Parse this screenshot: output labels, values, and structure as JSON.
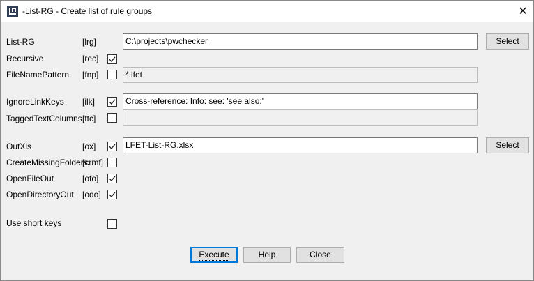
{
  "window": {
    "title": "-List-RG - Create list of rule groups",
    "close_glyph": "✕"
  },
  "rows": {
    "list_rg": {
      "label": "List-RG",
      "key": "[lrg]",
      "value": "C:\\projects\\pwchecker",
      "button": "Select"
    },
    "recursive": {
      "label": "Recursive",
      "key": "[rec]",
      "checked": true
    },
    "file_name_pattern": {
      "label": "FileNamePattern",
      "key": "[fnp]",
      "checked": false,
      "value": "*.lfet"
    },
    "ignore_link_keys": {
      "label": "IgnoreLinkKeys",
      "key": "[ilk]",
      "checked": true,
      "value": "Cross-reference: Info: see: 'see also:'"
    },
    "tagged_text_columns": {
      "label": "TaggedTextColumns",
      "key": "[ttc]",
      "checked": false,
      "value": ""
    },
    "out_xls": {
      "label": "OutXls",
      "key": "[ox]",
      "checked": true,
      "value": "LFET-List-RG.xlsx",
      "button": "Select"
    },
    "create_missing_folders": {
      "label": "CreateMissingFolders",
      "key": "[crmf]",
      "checked": false
    },
    "open_file_out": {
      "label": "OpenFileOut",
      "key": "[ofo]",
      "checked": true
    },
    "open_directory_out": {
      "label": "OpenDirectoryOut",
      "key": "[odo]",
      "checked": true
    },
    "use_short_keys": {
      "label": "Use short keys",
      "checked": false
    }
  },
  "buttons": {
    "execute": "Execute",
    "help": "Help",
    "close": "Close"
  }
}
